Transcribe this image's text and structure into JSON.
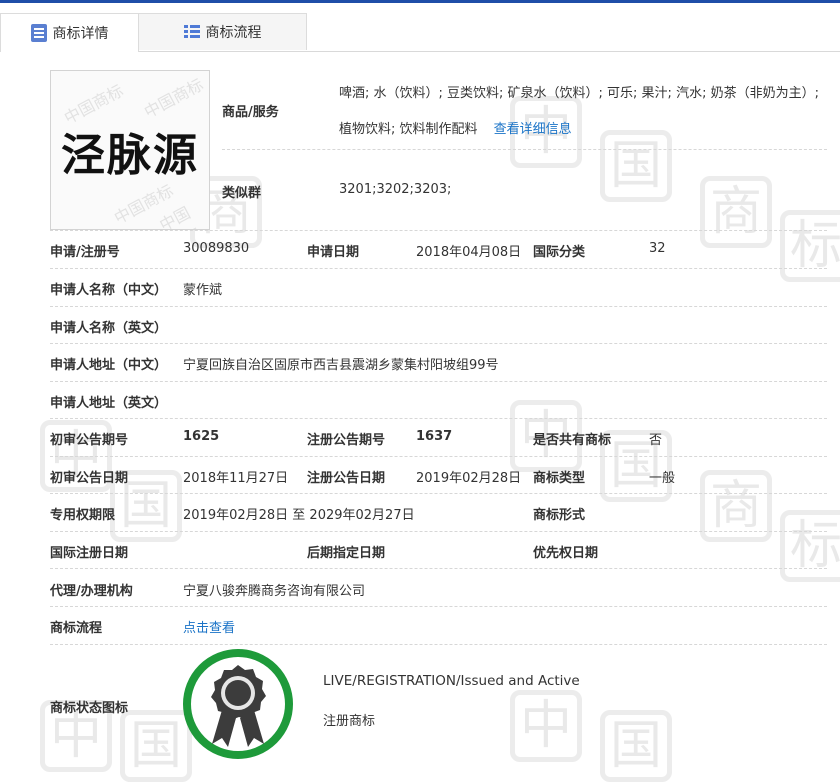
{
  "tabs": [
    {
      "label": "商标详情",
      "active": true
    },
    {
      "label": "商标流程",
      "active": false
    }
  ],
  "logo": {
    "text": "泾脉源",
    "stamp_text": "中国商标"
  },
  "goods_services": {
    "label": "商品/服务",
    "value": "啤酒; 水（饮料）; 豆类饮料; 矿泉水（饮料）; 可乐; 果汁; 汽水; 奶茶（非奶为主）; 植物饮料; 饮料制作配料",
    "more_link": "查看详细信息"
  },
  "similar_group": {
    "label": "类似群",
    "value": "3201;3202;3203;"
  },
  "fields": {
    "reg_no": {
      "label": "申请/注册号",
      "value": "30089830"
    },
    "apply_date": {
      "label": "申请日期",
      "value": "2018年04月08日"
    },
    "intl_class": {
      "label": "国际分类",
      "value": "32"
    },
    "applicant_cn": {
      "label": "申请人名称（中文）",
      "value": "蒙作斌"
    },
    "applicant_en": {
      "label": "申请人名称（英文）",
      "value": ""
    },
    "address_cn": {
      "label": "申请人地址（中文）",
      "value": "宁夏回族自治区固原市西吉县震湖乡蒙集村阳坡组99号"
    },
    "address_en": {
      "label": "申请人地址（英文）",
      "value": ""
    },
    "prelim_issue": {
      "label": "初审公告期号",
      "value": "1625"
    },
    "reg_issue": {
      "label": "注册公告期号",
      "value": "1637"
    },
    "shared": {
      "label": "是否共有商标",
      "value": "否"
    },
    "prelim_date": {
      "label": "初审公告日期",
      "value": "2018年11月27日"
    },
    "reg_date": {
      "label": "注册公告日期",
      "value": "2019年02月28日"
    },
    "tm_type": {
      "label": "商标类型",
      "value": "一般"
    },
    "exclusive_period": {
      "label": "专用权期限",
      "value": "2019年02月28日 至 2029年02月27日"
    },
    "tm_form": {
      "label": "商标形式",
      "value": ""
    },
    "intl_reg_date": {
      "label": "国际注册日期",
      "value": ""
    },
    "later_date": {
      "label": "后期指定日期",
      "value": ""
    },
    "priority_date": {
      "label": "优先权日期",
      "value": ""
    },
    "agent": {
      "label": "代理/办理机构",
      "value": "宁夏八骏奔腾商务咨询有限公司"
    },
    "process": {
      "label": "商标流程",
      "link": "点击查看"
    },
    "status_icon": {
      "label": "商标状态图标",
      "status_en": "LIVE/REGISTRATION/Issued and Active",
      "status_cn": "注册商标"
    }
  },
  "colors": {
    "accent": "#1f4ea8",
    "link": "#1a73c7",
    "badge_ring": "#1e9a3a",
    "badge_fill": "#3c3c3c"
  },
  "watermark": [
    "中",
    "国",
    "商",
    "标"
  ]
}
